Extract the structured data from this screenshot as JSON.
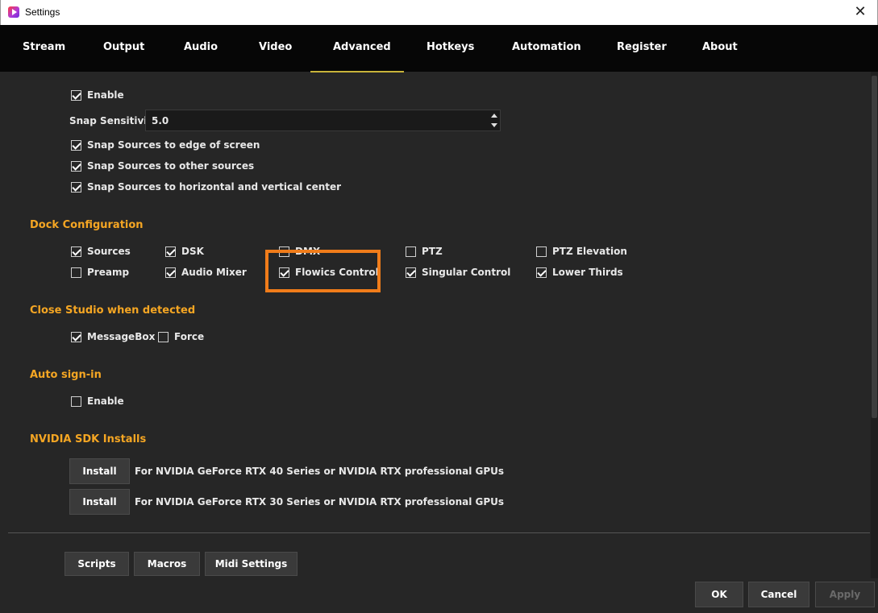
{
  "window": {
    "title": "Settings"
  },
  "tabs": [
    {
      "label": "Stream"
    },
    {
      "label": "Output"
    },
    {
      "label": "Audio"
    },
    {
      "label": "Video"
    },
    {
      "label": "Advanced"
    },
    {
      "label": "Hotkeys"
    },
    {
      "label": "Automation"
    },
    {
      "label": "Register"
    },
    {
      "label": "About"
    }
  ],
  "active_tab": "Advanced",
  "snapping": {
    "enable_label": "Enable",
    "enable_checked": true,
    "sensitivity_label": "Snap Sensitivity",
    "sensitivity_value": "5.0",
    "options": [
      {
        "label": "Snap Sources to edge of screen",
        "checked": true
      },
      {
        "label": "Snap Sources to other sources",
        "checked": true
      },
      {
        "label": "Snap Sources to horizontal and vertical center",
        "checked": true
      }
    ]
  },
  "dock": {
    "title": "Dock Configuration",
    "items": [
      {
        "label": "Sources",
        "checked": true
      },
      {
        "label": "DSK",
        "checked": true
      },
      {
        "label": "DMX",
        "checked": false
      },
      {
        "label": "PTZ",
        "checked": false
      },
      {
        "label": "PTZ Elevation",
        "checked": false
      },
      {
        "label": "Preamp",
        "checked": false
      },
      {
        "label": "Audio Mixer",
        "checked": true
      },
      {
        "label": "Flowics Control",
        "checked": true
      },
      {
        "label": "Singular Control",
        "checked": true
      },
      {
        "label": "Lower Thirds",
        "checked": true
      }
    ]
  },
  "close_studio": {
    "title": "Close Studio when detected",
    "items": [
      {
        "label": "MessageBox",
        "checked": true
      },
      {
        "label": "Force",
        "checked": false
      }
    ]
  },
  "auto_signin": {
    "title": "Auto sign-in",
    "enable_label": "Enable",
    "enable_checked": false
  },
  "nvidia": {
    "title": "NVIDIA SDK Installs",
    "installs": [
      {
        "button": "Install",
        "desc": "For NVIDIA GeForce RTX 40 Series or NVIDIA RTX professional GPUs"
      },
      {
        "button": "Install",
        "desc": "For NVIDIA GeForce RTX 30 Series or NVIDIA RTX professional GPUs"
      }
    ]
  },
  "bottom": {
    "scripts": "Scripts",
    "macros": "Macros",
    "midi": "Midi Settings",
    "ok": "OK",
    "cancel": "Cancel",
    "apply": "Apply"
  },
  "colors": {
    "section_title": "#f5a623",
    "highlight": "#f07c1a",
    "tab_underline": "#c8b43a"
  }
}
